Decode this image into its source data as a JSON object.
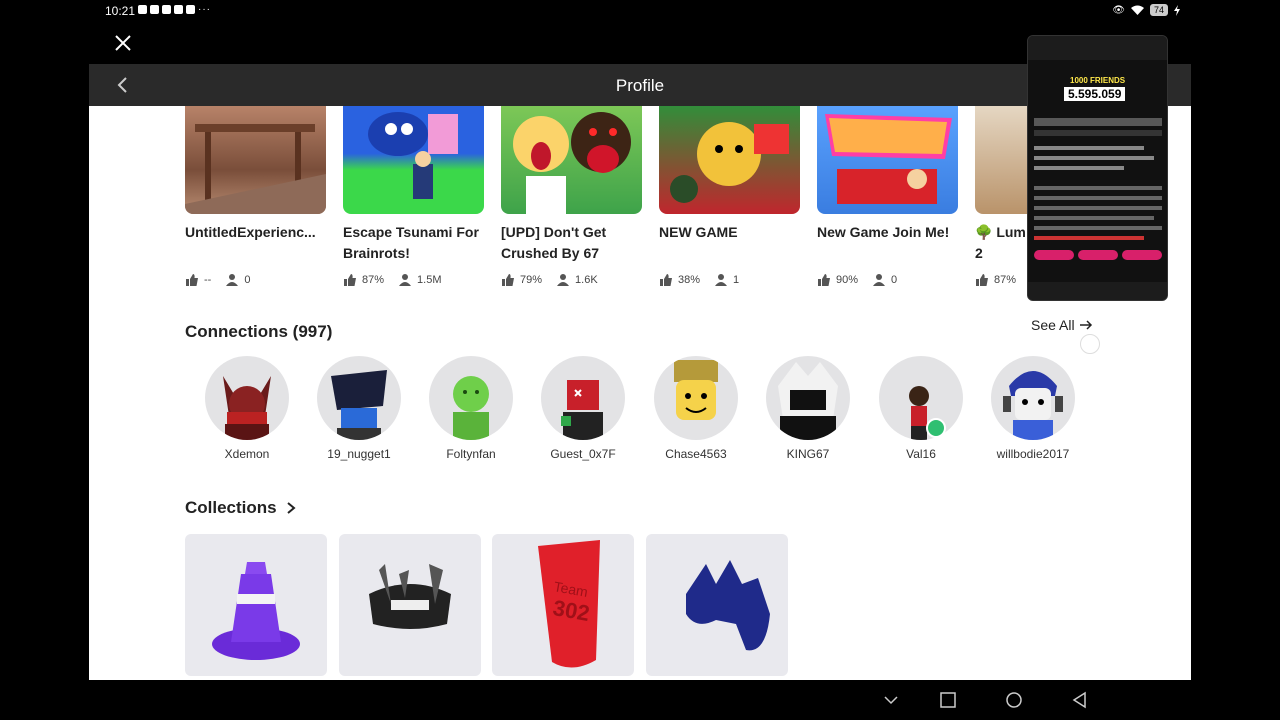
{
  "status": {
    "time": "10:21",
    "dots": "···",
    "battery": "74"
  },
  "header": {
    "title": "Profile"
  },
  "games": [
    {
      "title": "UntitledExperienc...",
      "rating": "--",
      "players": "0"
    },
    {
      "title": "Escape Tsunami For Brainrots!",
      "rating": "87%",
      "players": "1.5M"
    },
    {
      "title": "[UPD] Don't Get Crushed By 67",
      "rating": "79%",
      "players": "1.6K"
    },
    {
      "title": "NEW GAME",
      "rating": "38%",
      "players": "1"
    },
    {
      "title": "New Game Join Me!",
      "rating": "90%",
      "players": "0"
    },
    {
      "title": "🌳 Lum 2",
      "rating": "87%",
      "players": ""
    }
  ],
  "connections": {
    "title": "Connections (997)",
    "see_all": "See All",
    "people": [
      "Xdemon",
      "19_nugget1",
      "Foltynfan",
      "Guest_0x7F",
      "Chase4563",
      "KING67",
      "Val16",
      "willbodie2017"
    ]
  },
  "collections": {
    "title": "Collections"
  },
  "overlay": {
    "friends": "1000 FRIENDS",
    "count": "5.595.059"
  }
}
